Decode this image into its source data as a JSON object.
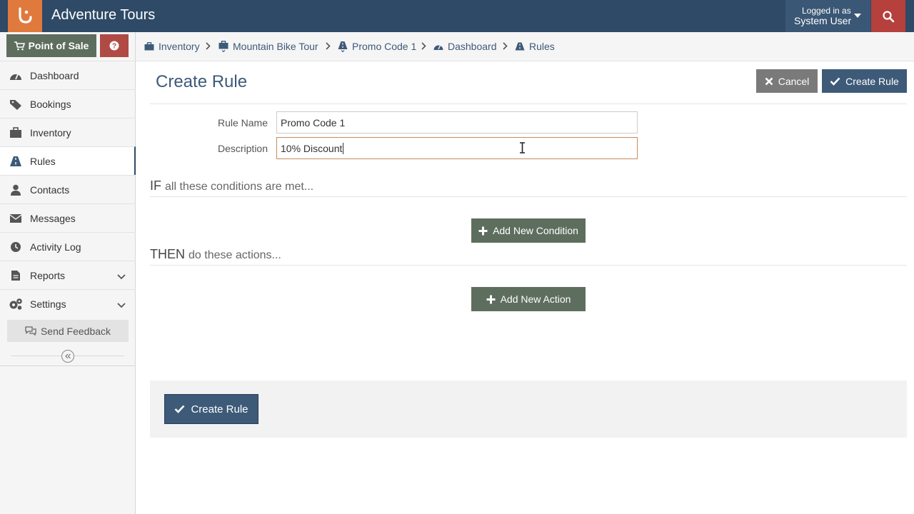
{
  "header": {
    "app_title": "Adventure Tours",
    "user_line1": "Logged in as",
    "user_line2": "System User",
    "logo_icon": "logo-icon",
    "search_icon": "search-icon"
  },
  "sidebar": {
    "pos_label": "Point of Sale",
    "items": [
      {
        "label": "Dashboard",
        "icon": "dashboard-icon"
      },
      {
        "label": "Bookings",
        "icon": "tag-icon"
      },
      {
        "label": "Inventory",
        "icon": "briefcase-icon"
      },
      {
        "label": "Rules",
        "icon": "road-icon",
        "active": true
      },
      {
        "label": "Contacts",
        "icon": "user-icon"
      },
      {
        "label": "Messages",
        "icon": "envelope-icon"
      },
      {
        "label": "Activity Log",
        "icon": "clock-icon"
      },
      {
        "label": "Reports",
        "icon": "file-icon"
      },
      {
        "label": "Settings",
        "icon": "cogs-icon"
      }
    ],
    "feedback_label": "Send Feedback"
  },
  "breadcrumb": [
    {
      "label": "Inventory"
    },
    {
      "label": "Mountain Bike Tour"
    },
    {
      "label": "Promo Code 1"
    },
    {
      "label": "Dashboard"
    },
    {
      "label": "Rules"
    }
  ],
  "page": {
    "title": "Create Rule",
    "cancel_label": "Cancel",
    "create_label": "Create Rule"
  },
  "form": {
    "rule_name_label": "Rule Name",
    "rule_name_value": "Promo Code 1",
    "description_label": "Description",
    "description_value": "10% Discount"
  },
  "conditions": {
    "head_strong": "IF",
    "head_rest": "all these conditions are met...",
    "add_label": "Add New Condition"
  },
  "actions": {
    "head_strong": "THEN",
    "head_rest": "do these actions...",
    "add_label": "Add New Action"
  },
  "colors": {
    "header_bg": "#2e4a66",
    "accent_orange": "#e0793c",
    "danger_red": "#b5403c",
    "primary_blue": "#3d5a78",
    "olive_button": "#5e6e5e"
  }
}
